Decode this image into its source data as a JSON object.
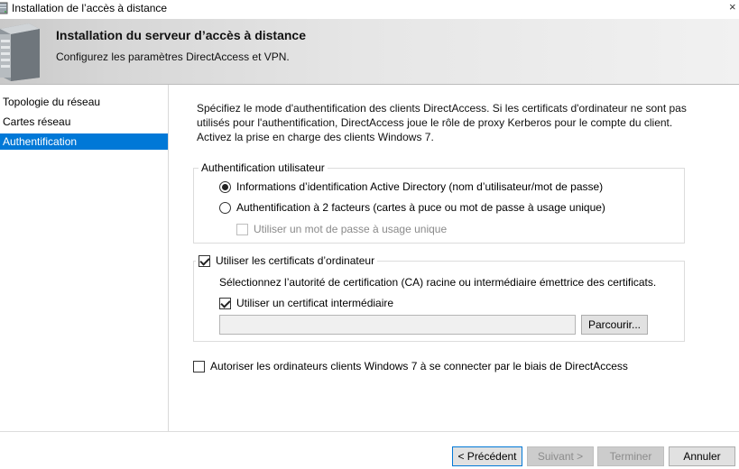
{
  "window": {
    "title": "Installation de l’accès à distance",
    "close_glyph": "×"
  },
  "header": {
    "title": "Installation du serveur d’accès à distance",
    "subtitle": "Configurez les paramètres DirectAccess et VPN."
  },
  "nav": {
    "items": [
      {
        "label": "Topologie du réseau",
        "selected": false
      },
      {
        "label": "Cartes réseau",
        "selected": false
      },
      {
        "label": "Authentification",
        "selected": true
      }
    ]
  },
  "content": {
    "intro_line1": "Spécifiez le mode d'authentification des clients DirectAccess. Si les certificats d'ordinateur ne sont pas",
    "intro_line2": "utilisés pour l'authentification, DirectAccess joue le rôle de proxy Kerberos pour le compte du client.",
    "intro_line3": "Activez la prise en charge des clients Windows 7.",
    "user_auth": {
      "legend": "Authentification utilisateur",
      "option_ad": {
        "label": "Informations d’identification Active Directory (nom d’utilisateur/mot de passe)",
        "checked": true
      },
      "option_2fa": {
        "label": "Authentification à 2 facteurs (cartes à puce ou mot de passe à usage unique)",
        "checked": false
      },
      "otp": {
        "label": "Utiliser un mot de passe à usage unique",
        "checked": false,
        "disabled": true
      }
    },
    "computer_certs": {
      "label": "Utiliser les certificats d’ordinateur",
      "checked": true,
      "description": "Sélectionnez l’autorité de certification (CA) racine ou intermédiaire émettrice des certificats.",
      "intermediate": {
        "label": "Utiliser un certificat intermédiaire",
        "checked": true
      },
      "path_value": "",
      "browse_label": "Parcourir..."
    },
    "win7": {
      "label": "Autoriser les ordinateurs clients Windows 7 à se connecter par le biais de DirectAccess",
      "checked": false
    }
  },
  "footer": {
    "previous": "< Précédent",
    "next": "Suivant >",
    "finish": "Terminer",
    "cancel": "Annuler"
  }
}
